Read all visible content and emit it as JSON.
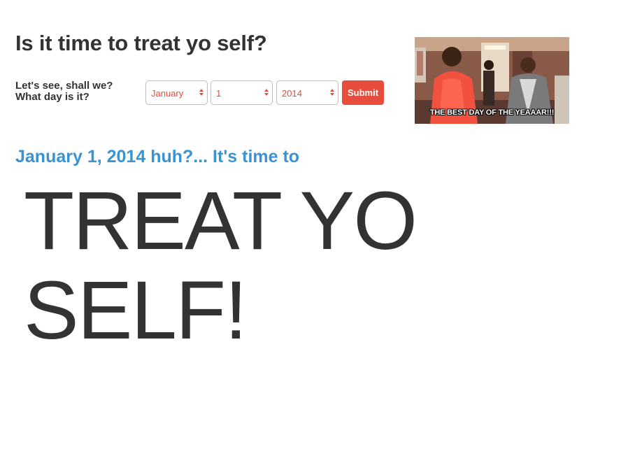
{
  "header": {
    "title": "Is it time to treat yo self?"
  },
  "form": {
    "prompt_line1": "Let's see, shall we?",
    "prompt_line2": "What day is it?",
    "month": "January",
    "day": "1",
    "year": "2014",
    "submit_label": "Submit",
    "accent_color": "#e74c3c"
  },
  "image": {
    "caption": "THE BEST DAY OF THE YEAAAR!!!"
  },
  "result": {
    "text": "January 1, 2014 huh?... It's time to",
    "color": "#3a93d2",
    "big_text": "TREAT YO SELF!"
  }
}
